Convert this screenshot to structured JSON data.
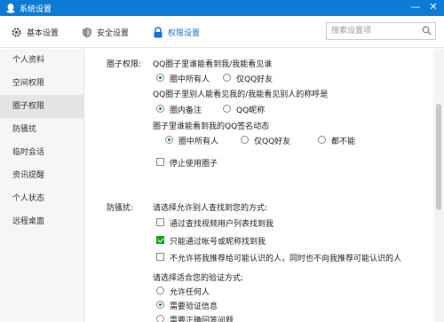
{
  "window": {
    "title": "系统设置",
    "minimize": "—",
    "close": "✕"
  },
  "toolbar": {
    "tabs": [
      {
        "label": "基本设置",
        "icon": "gear-icon"
      },
      {
        "label": "安全设置",
        "icon": "shield-icon"
      },
      {
        "label": "权限设置",
        "icon": "lock-icon",
        "active": true
      }
    ],
    "search_placeholder": "搜索设置项"
  },
  "sidebar": {
    "items": [
      {
        "label": "个人资料"
      },
      {
        "label": "空间权限"
      },
      {
        "label": "圈子权限",
        "active": true
      },
      {
        "label": "防骚扰"
      },
      {
        "label": "临时会话"
      },
      {
        "label": "资讯提醒"
      },
      {
        "label": "个人状态"
      },
      {
        "label": "远程桌面"
      }
    ]
  },
  "circle": {
    "heading": "圈子权限:",
    "q1": {
      "text": "QQ圈子里谁能看到我/我能看见谁",
      "options": [
        "圈中所有人",
        "仅QQ好友"
      ],
      "selected": 0
    },
    "q2": {
      "text": "QQ圈子里别人能看见我的/我能看见别人的称呼是",
      "options": [
        "圈内备注",
        "QQ昵称"
      ],
      "selected": 0
    },
    "q3": {
      "text": "圈子里谁能看到我的QQ签名动态",
      "options": [
        "圈中所有人",
        "仅QQ好友",
        "都不能"
      ],
      "selected": 0
    },
    "stop": {
      "label": "停止使用圈子",
      "checked": false
    }
  },
  "harass": {
    "heading": "防骚扰:",
    "find_title": "请选择允许别人查找到您的方式:",
    "find_options": [
      {
        "label": "通过查找视频用户列表找到我",
        "checked": false
      },
      {
        "label": "只能通过帐号或昵称找到我",
        "checked": true
      },
      {
        "label": "不允许将我推荐给可能认识的人，同时也不向我推荐可能认识的人",
        "checked": false
      }
    ],
    "verify_title": "请选择适合您的验证方式:",
    "verify_options": [
      "允许任何人",
      "需要验证信息",
      "需要正确回答问题"
    ],
    "verify_selected": 1
  }
}
